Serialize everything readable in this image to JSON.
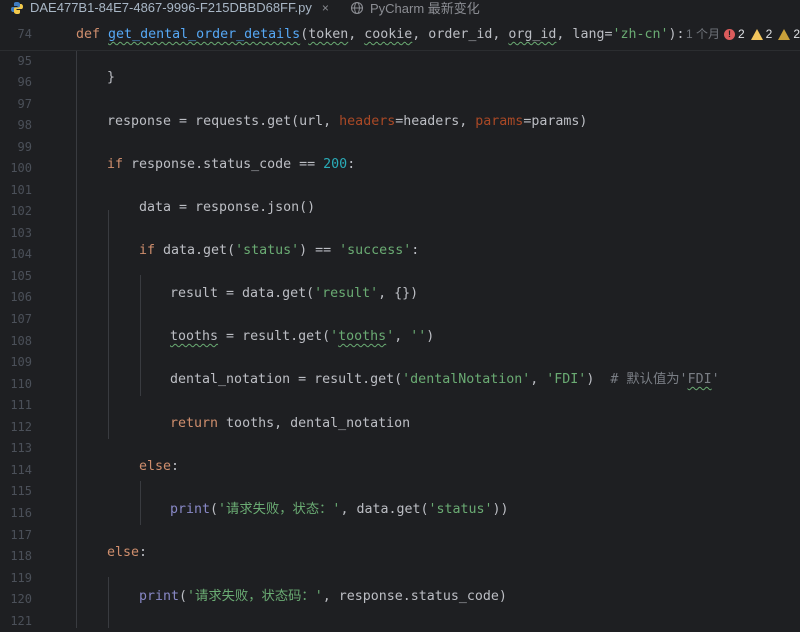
{
  "tabs": [
    {
      "label": "DAE477B1-84E7-4867-9996-F215DBBD68FF.py",
      "close": "×",
      "icon": "python-icon",
      "active": true
    },
    {
      "label": "PyCharm 最新变化",
      "icon": "globe-icon",
      "active": false
    }
  ],
  "sticky": {
    "line_no": "74",
    "def_kw": "def",
    "fn_name": "get_dental_order_details",
    "open_paren": "(",
    "p1": "token",
    "sep1": ", ",
    "p2": "cookie",
    "sep2": ", order_id, ",
    "p3": "org_id",
    "sep3": ", lang=",
    "lang_val": "'zh-cn'",
    "close": "):",
    "blame": "1 个月"
  },
  "inspections": {
    "errors": "2",
    "warnings": "2",
    "weak": "2"
  },
  "lines": [
    {
      "n": "95"
    },
    {
      "n": "96",
      "brace": "}"
    },
    {
      "n": "97"
    },
    {
      "n": "98",
      "a": "response = requests.get(url, ",
      "h_kw": "headers",
      "b": "=headers, ",
      "p_kw": "params",
      "c": "=params)"
    },
    {
      "n": "99"
    },
    {
      "n": "100",
      "kw": "if",
      "a": " response.status_code == ",
      "num": "200",
      "b": ":"
    },
    {
      "n": "101"
    },
    {
      "n": "102",
      "a": "data = response.json()"
    },
    {
      "n": "103"
    },
    {
      "n": "104",
      "kw": "if",
      "a": " data.get(",
      "s1": "'status'",
      "b": ") == ",
      "s2": "'success'",
      "c": ":"
    },
    {
      "n": "105"
    },
    {
      "n": "106",
      "a": "result = data.get(",
      "s1": "'result'",
      "b": ", {})"
    },
    {
      "n": "107"
    },
    {
      "n": "108",
      "v": "tooths",
      "a": " = result.get(",
      "s1a": "'",
      "s1w": "tooths",
      "s1b": "'",
      "b": ", ",
      "s2": "''",
      "c": ")"
    },
    {
      "n": "109"
    },
    {
      "n": "110",
      "a": "dental_notation = result.get(",
      "s1": "'dentalNotation'",
      "b": ", ",
      "s2": "'FDI'",
      "c": ")  ",
      "cmt": "# 默认值为'",
      "cmtw": "FDI",
      "cmte": "'"
    },
    {
      "n": "111"
    },
    {
      "n": "112",
      "kw": "return",
      "a": " tooths, dental_notation"
    },
    {
      "n": "113"
    },
    {
      "n": "114",
      "kw": "else",
      "a": ":"
    },
    {
      "n": "115"
    },
    {
      "n": "116",
      "fn": "print",
      "a": "(",
      "s1": "'请求失败，状态：'",
      "b": ", data.get(",
      "s2": "'status'",
      "c": "))"
    },
    {
      "n": "117"
    },
    {
      "n": "118",
      "kw": "else",
      "a": ":"
    },
    {
      "n": "119"
    },
    {
      "n": "120",
      "fn": "print",
      "a": "(",
      "s1": "'请求失败，状态码：'",
      "b": ", response.status_code)"
    },
    {
      "n": "121"
    }
  ]
}
